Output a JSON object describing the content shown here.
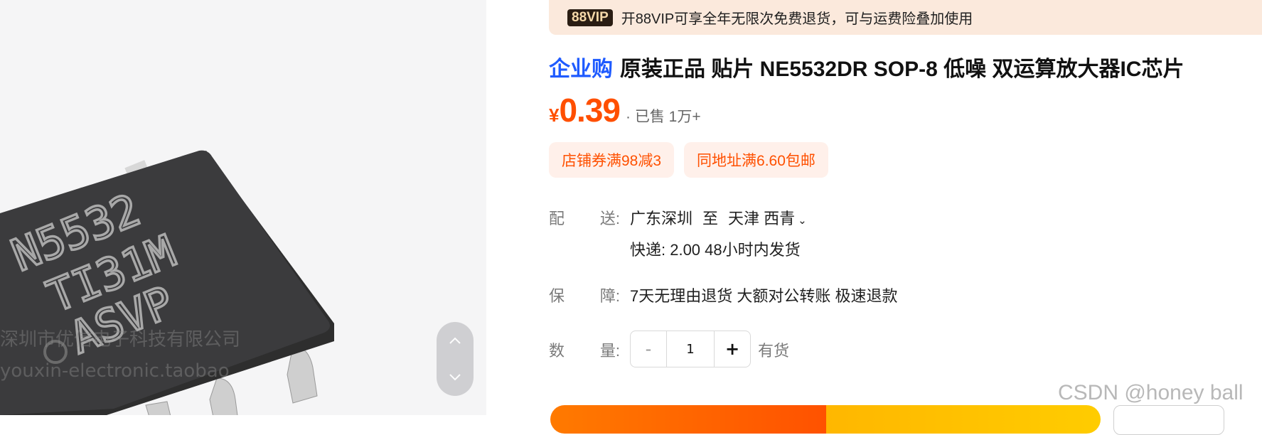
{
  "vip": {
    "badge": "88VIP",
    "text": "开88VIP可享全年无限次免费退货，可与运费险叠加使用"
  },
  "product": {
    "tag": "企业购",
    "title": "原装正品 贴片 NE5532DR SOP-8 低噪 双运算放大器IC芯片",
    "price_symbol": "¥",
    "price": "0.39",
    "sold": "· 已售 1万+"
  },
  "chip_image": {
    "markings": [
      "N5532",
      "TI31M",
      "ASVP"
    ],
    "watermark_cn": "深圳市优信电子科技有限公司",
    "watermark_en": "youxin-electronic.taobao"
  },
  "coupons": [
    "店铺券满98减3",
    "同地址满6.60包邮"
  ],
  "delivery": {
    "label_a": "配",
    "label_b": "送:",
    "from": "广东深圳",
    "to_word": "至",
    "to": "天津 西青",
    "shipping": "快递: 2.00  48小时内发货"
  },
  "guarantee": {
    "label_a": "保",
    "label_b": "障:",
    "text": "7天无理由退货 大额对公转账 极速退款"
  },
  "quantity": {
    "label_a": "数",
    "label_b": "量:",
    "minus": "-",
    "value": "1",
    "plus": "+",
    "stock": "有货"
  },
  "page_watermark": "CSDN @honey ball",
  "icons": {
    "nav_up": "chevron-up-icon",
    "nav_down": "chevron-down-icon",
    "address": "chevron-down-icon"
  },
  "colors": {
    "price": "#ff4f00",
    "tag": "#1f5bff",
    "banner": "#fbe9dc",
    "coupon_bg": "#fff0ea"
  }
}
